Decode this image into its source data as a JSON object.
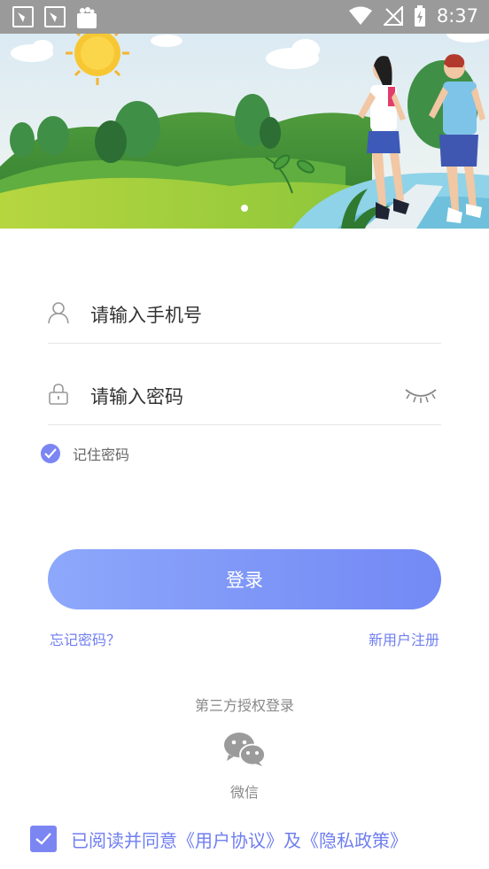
{
  "status_bar": {
    "time": "8:37",
    "icons": [
      "app-notification-icon",
      "app-notification-icon",
      "shopping-bag-icon",
      "wifi-icon",
      "no-signal-icon",
      "battery-charging-icon"
    ]
  },
  "banner": {
    "slide_count": 1,
    "active_slide": 1
  },
  "login": {
    "phone_placeholder": "请输入手机号",
    "password_placeholder": "请输入密码",
    "remember_label": "记住密码",
    "remember_checked": true,
    "login_button": "登录",
    "forgot_link": "忘记密码？",
    "register_link": "新用户注册"
  },
  "third_party": {
    "title": "第三方授权登录",
    "wechat_label": "微信"
  },
  "agreement": {
    "checked": true,
    "text": "已阅读并同意《用户协议》及《隐私政策》"
  },
  "colors": {
    "accent": "#7b86f3",
    "link": "#6f7ef0",
    "status_bar": "#9a9a9a"
  }
}
